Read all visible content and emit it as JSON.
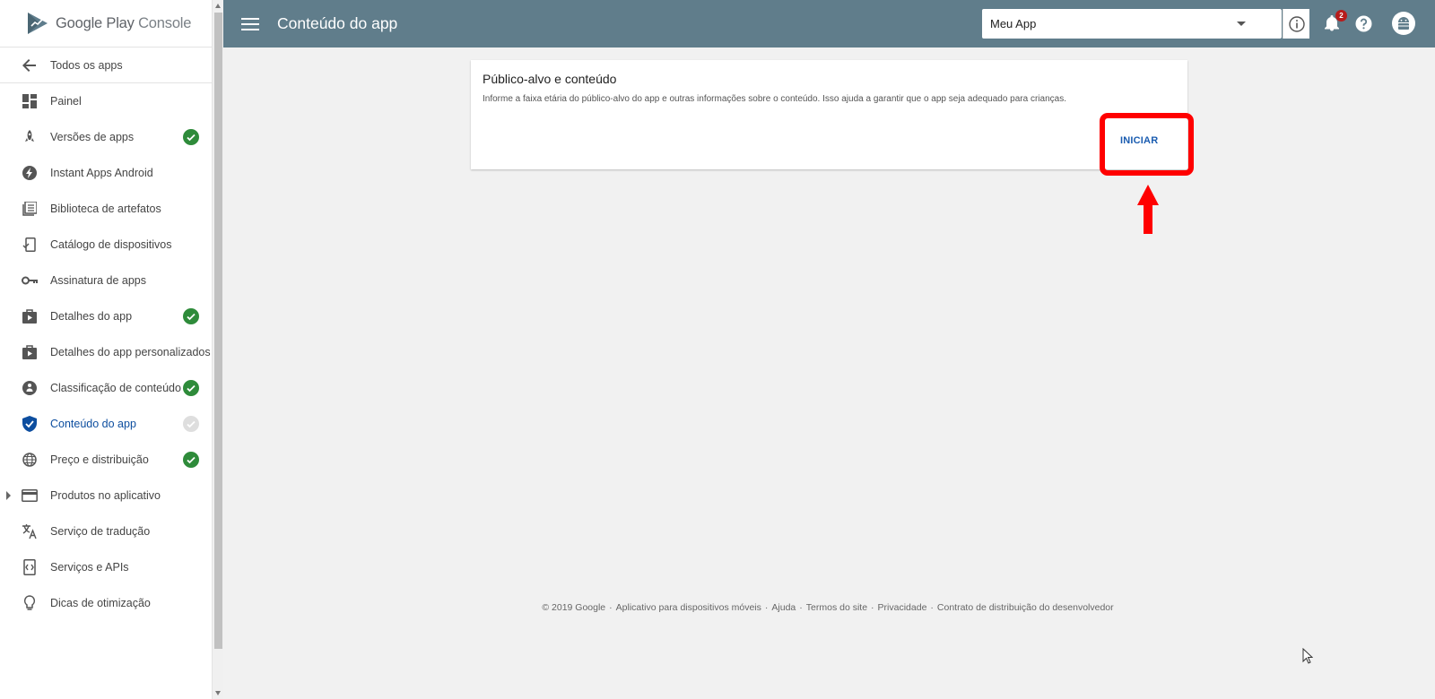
{
  "brand": {
    "name": "Google Play",
    "product": "Console"
  },
  "back": {
    "label": "Todos os apps"
  },
  "sidebar": {
    "items": [
      {
        "label": "Painel",
        "icon": "dashboard-icon",
        "status": ""
      },
      {
        "label": "Versões de apps",
        "icon": "rocket-icon",
        "status": "complete"
      },
      {
        "label": "Instant Apps Android",
        "icon": "bolt-icon",
        "status": ""
      },
      {
        "label": "Biblioteca de artefatos",
        "icon": "library-icon",
        "status": ""
      },
      {
        "label": "Catálogo de dispositivos",
        "icon": "device-catalog-icon",
        "status": ""
      },
      {
        "label": "Assinatura de apps",
        "icon": "key-icon",
        "status": ""
      },
      {
        "label": "Detalhes do app",
        "icon": "play-store-icon",
        "status": "complete"
      },
      {
        "label": "Detalhes do app personalizados",
        "icon": "play-store-icon",
        "status": ""
      },
      {
        "label": "Classificação de conteúdo",
        "icon": "content-rating-icon",
        "status": "complete"
      },
      {
        "label": "Conteúdo do app",
        "icon": "shield-check-icon",
        "status": "pending",
        "active": true
      },
      {
        "label": "Preço e distribuição",
        "icon": "globe-icon",
        "status": "complete"
      },
      {
        "label": "Produtos no aplicativo",
        "icon": "credit-card-icon",
        "status": "",
        "expandable": true
      },
      {
        "label": "Serviço de tradução",
        "icon": "translate-icon",
        "status": ""
      },
      {
        "label": "Serviços e APIs",
        "icon": "api-icon",
        "status": ""
      },
      {
        "label": "Dicas de otimização",
        "icon": "lightbulb-icon",
        "status": ""
      }
    ]
  },
  "header": {
    "title": "Conteúdo do app",
    "app_selector": {
      "value": "Meu App"
    },
    "notifications_count": "2"
  },
  "card": {
    "title": "Público-alvo e conteúdo",
    "description": "Informe a faixa etária do público-alvo do app e outras informações sobre o conteúdo. Isso ajuda a garantir que o app seja adequado para crianças.",
    "button_label": "INICIAR"
  },
  "footer": {
    "copyright": "© 2019 Google",
    "links": [
      "Aplicativo para dispositivos móveis",
      "Ajuda",
      "Termos do site",
      "Privacidade",
      "Contrato de distribuição do desenvolvedor"
    ]
  },
  "colors": {
    "topbar": "#607d8b",
    "accent": "#0d4e9f",
    "status_complete": "#2e8b3a",
    "annotation": "#ff0000"
  }
}
